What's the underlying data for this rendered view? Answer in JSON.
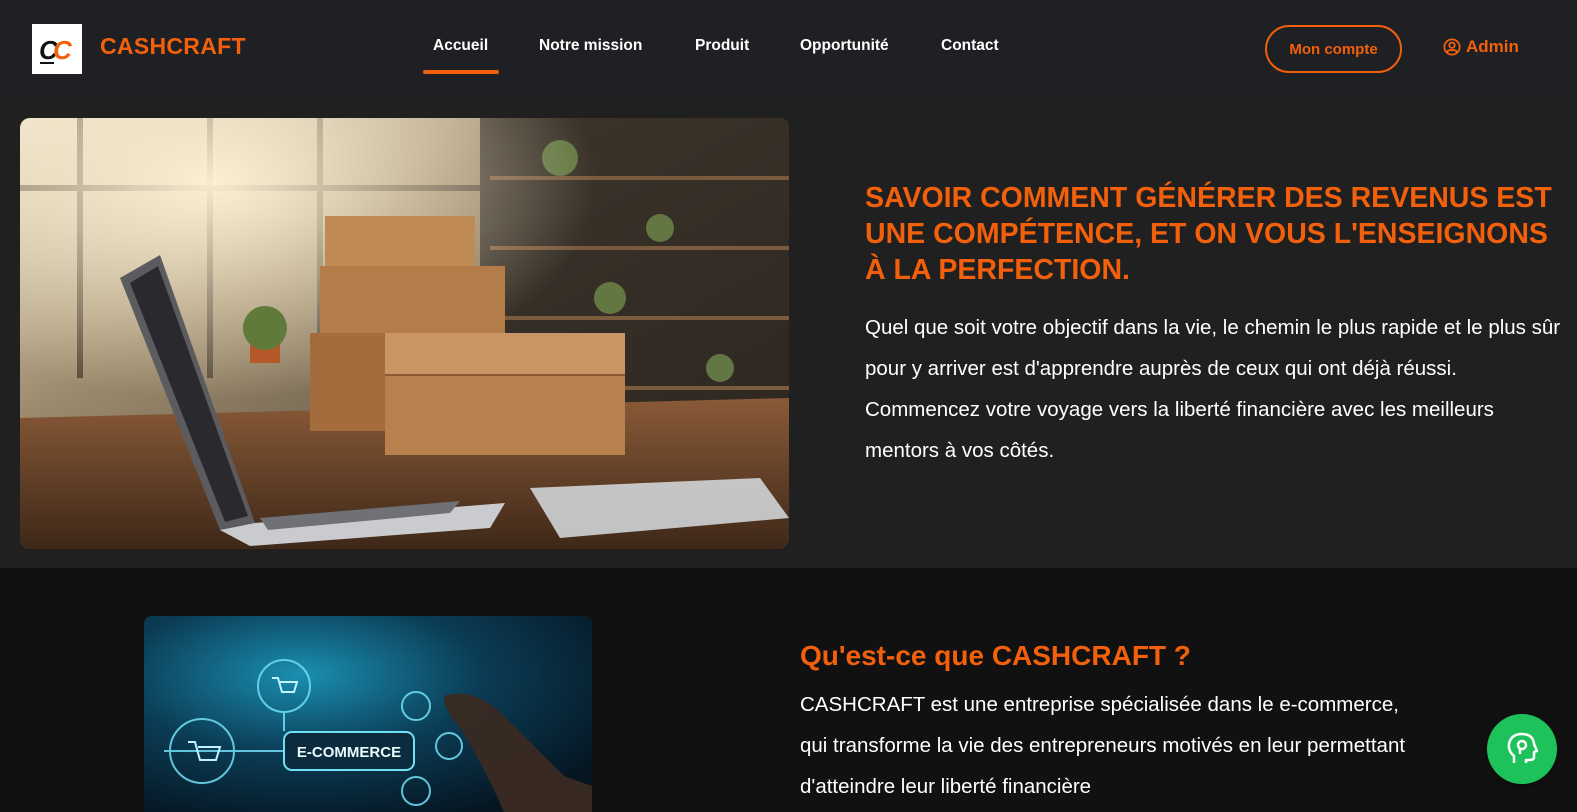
{
  "header": {
    "logo_text": "CC",
    "brand": "CASHCRAFT",
    "nav": [
      {
        "label": "Accueil",
        "active": true
      },
      {
        "label": "Notre mission",
        "active": false
      },
      {
        "label": "Produit",
        "active": false
      },
      {
        "label": "Opportunité",
        "active": false
      },
      {
        "label": "Contact",
        "active": false
      }
    ],
    "account_button": "Mon compte",
    "admin_label": "Admin",
    "admin_icon": "user-circle-icon"
  },
  "hero": {
    "image_subject": "laptop-and-cardboard-boxes",
    "title": "SAVOIR COMMENT GÉNÉRER DES REVENUS EST UNE COMPÉTENCE, ET ON VOUS L'ENSEIGNONS À LA PERFECTION.",
    "text": "Quel que soit votre objectif dans la vie, le chemin le plus rapide et le plus sûr pour y arriver est d'apprendre auprès de ceux qui ont déjà réussi. Commencez votre voyage vers la liberté financière avec les meilleurs mentors à vos côtés."
  },
  "about": {
    "image_label": "E-COMMERCE",
    "title": "Qu'est-ce que CASHCRAFT ?",
    "text": "CASHCRAFT est une entreprise spécialisée dans le e-commerce, qui transforme la vie des entrepreneurs motivés en leur permettant d'atteindre leur liberté financière"
  },
  "chat": {
    "icon": "support-head-icon"
  },
  "colors": {
    "accent": "#f2600c",
    "header_bg": "#1f2023",
    "hero_bg": "#202020",
    "section_bg": "#111111",
    "chat": "#1ec25b"
  }
}
